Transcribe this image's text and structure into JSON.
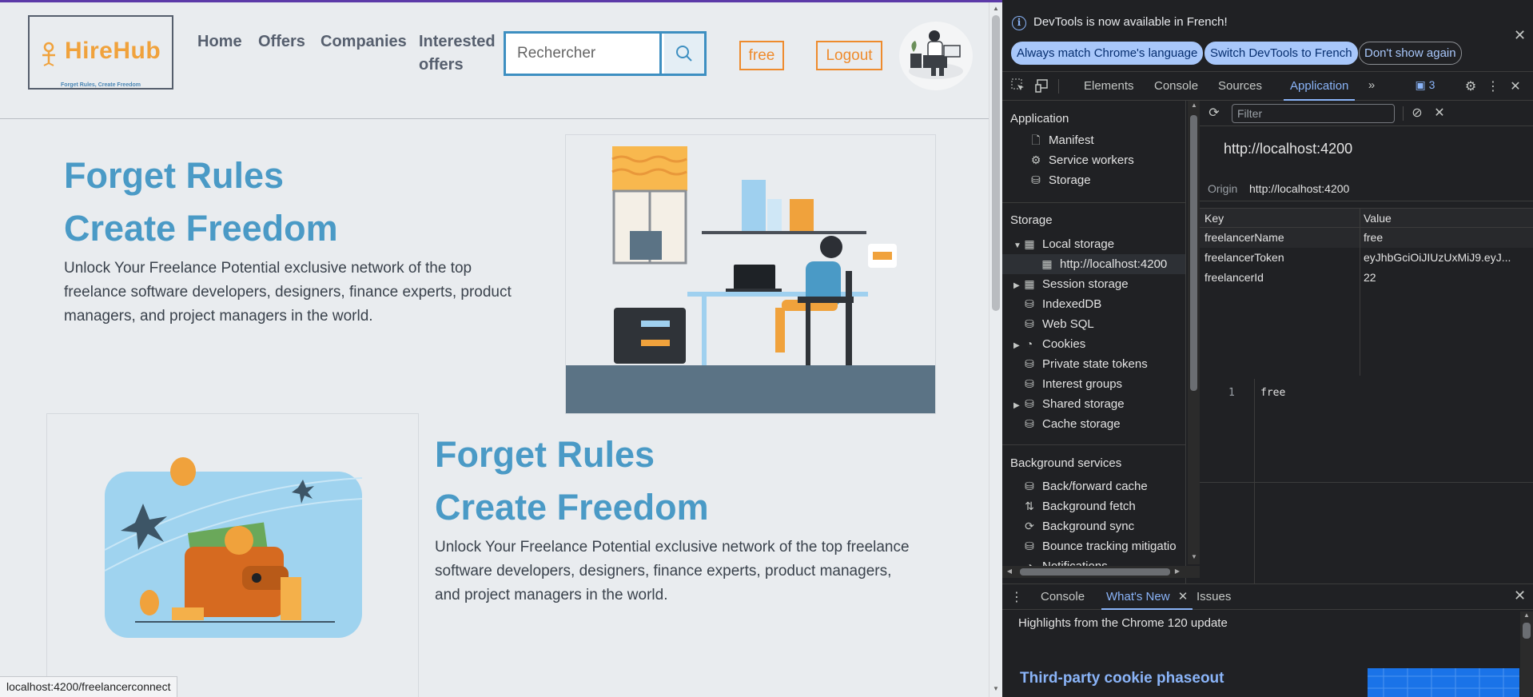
{
  "webpage": {
    "logo": {
      "name": "HireHub",
      "tagline": "Forget Rules, Create Freedom"
    },
    "nav": [
      {
        "label": "Home"
      },
      {
        "label": "Offers"
      },
      {
        "label": "Companies"
      },
      {
        "label": "Interested",
        "label2": "offers"
      }
    ],
    "search": {
      "placeholder": "Rechercher"
    },
    "user_button": "free",
    "logout_button": "Logout",
    "hero1": {
      "line1": "Forget Rules",
      "line2": "Create Freedom",
      "text": "Unlock Your Freelance Potential exclusive network of the top freelance software developers, designers, finance experts, product managers, and project managers in the world."
    },
    "hero2": {
      "line1": "Forget Rules",
      "line2": "Create Freedom",
      "text": "Unlock Your Freelance Potential exclusive network of the top freelance software developers, designers, finance experts, product managers, and project managers in the world."
    },
    "status_url": "localhost:4200/freelancerconnect"
  },
  "devtools": {
    "infobar": {
      "message": "DevTools is now available in French!",
      "btn_match": "Always match Chrome's language",
      "btn_switch": "Switch DevTools to French",
      "btn_dismiss": "Don't show again"
    },
    "tabs": [
      "Elements",
      "Console",
      "Sources",
      "Application"
    ],
    "active_tab": "Application",
    "issues_count": "3",
    "sidebar": {
      "application_header": "Application",
      "application_items": [
        "Manifest",
        "Service workers",
        "Storage"
      ],
      "storage_header": "Storage",
      "storage_items": [
        "Local storage",
        "http://localhost:4200",
        "Session storage",
        "IndexedDB",
        "Web SQL",
        "Cookies",
        "Private state tokens",
        "Interest groups",
        "Shared storage",
        "Cache storage"
      ],
      "background_header": "Background services",
      "background_items": [
        "Back/forward cache",
        "Background fetch",
        "Background sync",
        "Bounce tracking mitigatio",
        "Notifications"
      ]
    },
    "main": {
      "filter_placeholder": "Filter",
      "origin_heading": "http://localhost:4200",
      "origin_label": "Origin",
      "origin_value": "http://localhost:4200",
      "columns": [
        "Key",
        "Value"
      ],
      "rows": [
        {
          "key": "freelancerName",
          "value": "free"
        },
        {
          "key": "freelancerToken",
          "value": "eyJhbGciOiJIUzUxMiJ9.eyJ..."
        },
        {
          "key": "freelancerId",
          "value": "22"
        }
      ],
      "preview_line": "1",
      "preview_value": "free"
    },
    "drawer": {
      "tabs": [
        "Console",
        "What's New",
        "Issues"
      ],
      "active_tab": "What's New",
      "highlights": "Highlights from the Chrome 120 update",
      "article_title": "Third-party cookie phaseout"
    }
  },
  "colors": {
    "accent_blue": "#4a9ac6",
    "accent_orange": "#ee8b2d",
    "devtools_bg": "#202124",
    "devtools_accent": "#8ab4f8"
  }
}
